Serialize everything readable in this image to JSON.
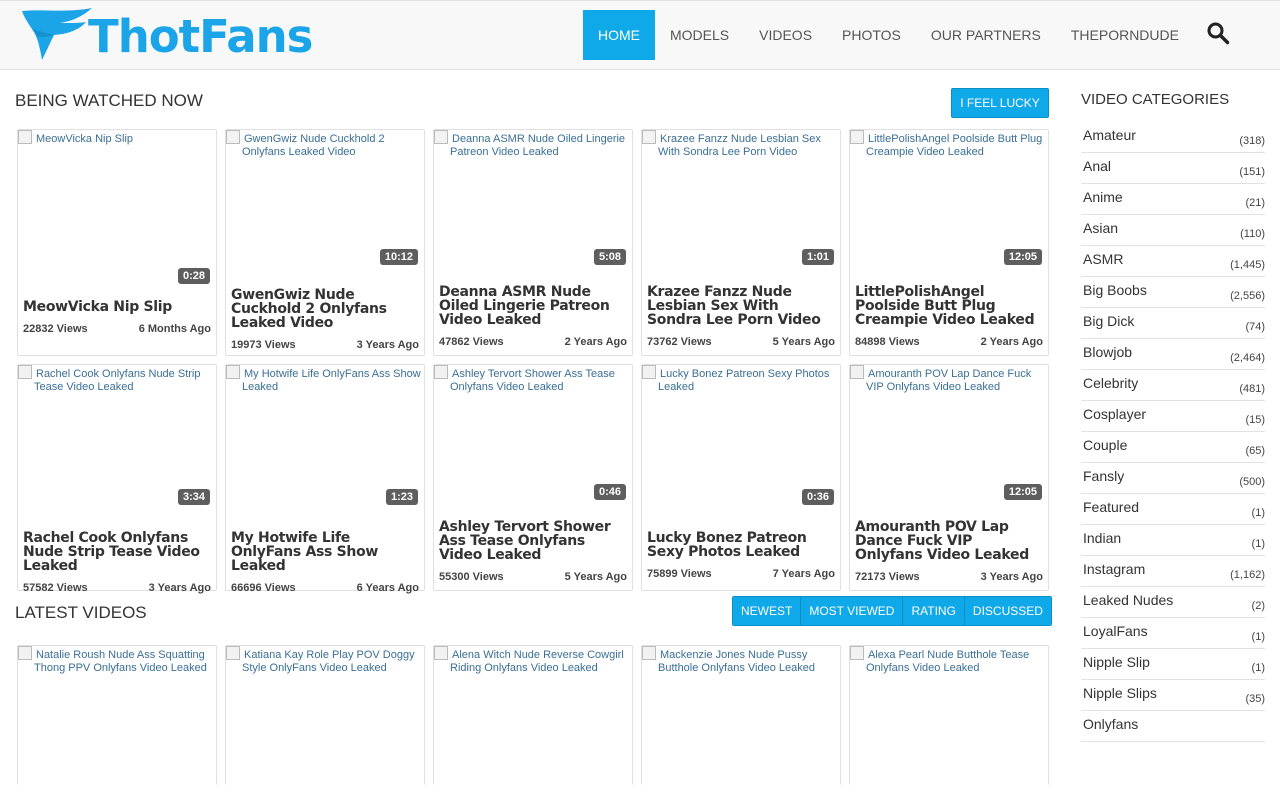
{
  "brand": {
    "name": "ThotFans",
    "color": "#1ba4e8"
  },
  "nav": {
    "items": [
      "HOME",
      "MODELS",
      "VIDEOS",
      "PHOTOS",
      "OUR PARTNERS",
      "THEPORNDUDE"
    ],
    "active": "HOME",
    "accent": "#0fa8e8"
  },
  "watching": {
    "title": "BEING WATCHED NOW",
    "lucky_label": "I FEEL LUCKY",
    "videos": [
      {
        "alt": "MeowVicka Nip Slip",
        "duration": "0:28",
        "title": "MeowVicka Nip Slip",
        "views": "22832 Views",
        "age": "6 Months Ago"
      },
      {
        "alt": "GwenGwiz Nude Cuckhold 2 Onlyfans Leaked Video",
        "duration": "10:12",
        "title": "GwenGwiz Nude Cuckhold 2 Onlyfans Leaked Video",
        "views": "19973 Views",
        "age": "3 Years Ago"
      },
      {
        "alt": "Deanna ASMR Nude Oiled Lingerie Patreon Video Leaked",
        "duration": "5:08",
        "title": "Deanna ASMR Nude Oiled Lingerie Patreon Video Leaked",
        "views": "47862 Views",
        "age": "2 Years Ago"
      },
      {
        "alt": "Krazee Fanzz Nude Lesbian Sex With Sondra Lee Porn Video",
        "duration": "1:01",
        "title": "Krazee Fanzz Nude Lesbian Sex With Sondra Lee Porn Video",
        "views": "73762 Views",
        "age": "5 Years Ago"
      },
      {
        "alt": "LittlePolishAngel Poolside Butt Plug Creampie Video Leaked",
        "duration": "12:05",
        "title": "LittlePolishAngel Poolside Butt Plug Creampie Video Leaked",
        "views": "84898 Views",
        "age": "2 Years Ago"
      },
      {
        "alt": "Rachel Cook Onlyfans Nude Strip Tease Video Leaked",
        "duration": "3:34",
        "title": "Rachel Cook Onlyfans Nude Strip Tease Video Leaked",
        "views": "57582 Views",
        "age": "3 Years Ago"
      },
      {
        "alt": "My Hotwife Life OnlyFans Ass Show Leaked",
        "duration": "1:23",
        "title": "My Hotwife Life OnlyFans Ass Show Leaked",
        "views": "66696 Views",
        "age": "6 Years Ago"
      },
      {
        "alt": "Ashley Tervort Shower Ass Tease Onlyfans Video Leaked",
        "duration": "0:46",
        "title": "Ashley Tervort Shower Ass Tease Onlyfans Video Leaked",
        "views": "55300 Views",
        "age": "5 Years Ago"
      },
      {
        "alt": "Lucky Bonez Patreon Sexy Photos Leaked",
        "duration": "0:36",
        "title": "Lucky Bonez Patreon Sexy Photos Leaked",
        "views": "75899 Views",
        "age": "7 Years Ago"
      },
      {
        "alt": "Amouranth POV Lap Dance Fuck VIP Onlyfans Video Leaked",
        "duration": "12:05",
        "title": "Amouranth POV Lap Dance Fuck VIP Onlyfans Video Leaked",
        "views": "72173 Views",
        "age": "3 Years Ago"
      }
    ]
  },
  "latest": {
    "title": "LATEST VIDEOS",
    "sort_buttons": [
      "NEWEST",
      "MOST VIEWED",
      "RATING",
      "DISCUSSED"
    ],
    "videos": [
      {
        "alt": "Natalie Roush Nude Ass Squatting Thong PPV Onlyfans Video Leaked"
      },
      {
        "alt": "Katiana Kay Role Play POV Doggy Style OnlyFans Video Leaked"
      },
      {
        "alt": "Alena Witch Nude Reverse Cowgirl Riding Onlyfans Video Leaked"
      },
      {
        "alt": "Mackenzie Jones Nude Pussy Butthole Onlyfans Video Leaked"
      },
      {
        "alt": "Alexa Pearl Nude Butthole Tease Onlyfans Video Leaked"
      }
    ]
  },
  "sidebar": {
    "title": "VIDEO CATEGORIES",
    "categories": [
      {
        "name": "Amateur",
        "count": "(318)"
      },
      {
        "name": "Anal",
        "count": "(151)"
      },
      {
        "name": "Anime",
        "count": "(21)"
      },
      {
        "name": "Asian",
        "count": "(110)"
      },
      {
        "name": "ASMR",
        "count": "(1,445)"
      },
      {
        "name": "Big Boobs",
        "count": "(2,556)"
      },
      {
        "name": "Big Dick",
        "count": "(74)"
      },
      {
        "name": "Blowjob",
        "count": "(2,464)"
      },
      {
        "name": "Celebrity",
        "count": "(481)"
      },
      {
        "name": "Cosplayer",
        "count": "(15)"
      },
      {
        "name": "Couple",
        "count": "(65)"
      },
      {
        "name": "Fansly",
        "count": "(500)"
      },
      {
        "name": "Featured",
        "count": "(1)"
      },
      {
        "name": "Indian",
        "count": "(1)"
      },
      {
        "name": "Instagram",
        "count": "(1,162)"
      },
      {
        "name": "Leaked Nudes",
        "count": "(2)"
      },
      {
        "name": "LoyalFans",
        "count": "(1)"
      },
      {
        "name": "Nipple Slip",
        "count": "(1)"
      },
      {
        "name": "Nipple Slips",
        "count": "(35)"
      },
      {
        "name": "Onlyfans",
        "count": ""
      }
    ]
  }
}
